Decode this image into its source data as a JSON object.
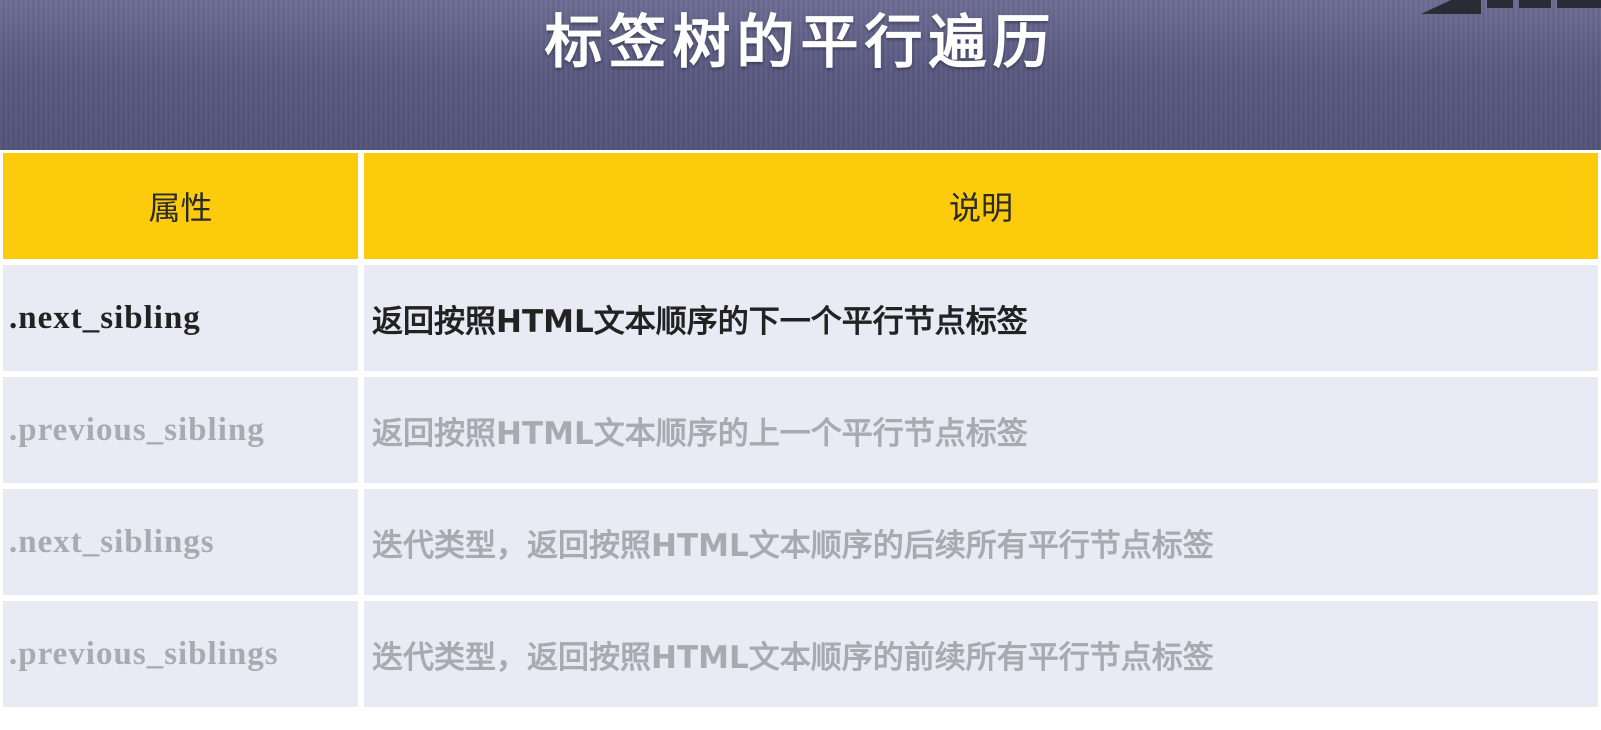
{
  "title": "标签树的平行遍历",
  "colors": {
    "header_band": "#5b5b83",
    "table_header": "#fccb0c",
    "row_bg": "#e9eaf3",
    "text_active": "#222222",
    "text_dim": "#a9a9b0"
  },
  "table": {
    "headers": [
      "属性",
      "说明"
    ],
    "rows": [
      {
        "attr": ".next_sibling",
        "desc": "返回按照HTML文本顺序的下一个平行节点标签",
        "state": "active"
      },
      {
        "attr": ".previous_sibling",
        "desc": "返回按照HTML文本顺序的上一个平行节点标签",
        "state": "dim"
      },
      {
        "attr": ".next_siblings",
        "desc": "迭代类型，返回按照HTML文本顺序的后续所有平行节点标签",
        "state": "dim"
      },
      {
        "attr": ".previous_siblings",
        "desc": "迭代类型，返回按照HTML文本顺序的前续所有平行节点标签",
        "state": "dim"
      }
    ]
  }
}
